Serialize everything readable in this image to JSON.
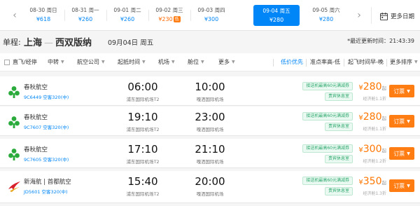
{
  "date_strip": {
    "prev_arrow": "‹",
    "next_arrow": "›",
    "dates": [
      {
        "label": "08-30 周日",
        "price": "¥618"
      },
      {
        "label": "08-31 周一",
        "price": "¥260"
      },
      {
        "label": "09-01 周二",
        "price": "¥260"
      },
      {
        "label": "09-02 周三",
        "price": "¥230",
        "tag": "低"
      },
      {
        "label": "09-03 周四",
        "price": "¥300"
      },
      {
        "label": "09-04 周五",
        "price": "¥280"
      },
      {
        "label": "09-05 周六",
        "price": "¥280"
      }
    ],
    "more_dates_label": "更多日期"
  },
  "route": {
    "trip_type": "单程:",
    "from": "上海",
    "dash": "—",
    "to": "西双版纳",
    "date": "09月04日 周五",
    "update_prefix": "*最近更新时间：",
    "update_time": "21:43:39"
  },
  "filters": {
    "direct_label": "直飞/经停",
    "items": [
      "中转",
      "航空公司",
      "起抵时间",
      "机场",
      "舱位",
      "更多"
    ],
    "sorts": [
      "低价优先",
      "准点率高-低",
      "起飞时间早-晚",
      "更多排序"
    ]
  },
  "flights": [
    {
      "airline": "春秋航空",
      "flight": "9C6449 空客320(中)",
      "dep_time": "06:00",
      "dep_airport": "浦东国际机场T2",
      "arr_time": "10:00",
      "arr_airport": "嘎洒国际机场",
      "promo1": "接送机最高60元满减券",
      "promo2": "贵宾休息室",
      "price": "280",
      "currency": "¥",
      "suffix": "起",
      "discount": "经济舱1.1折",
      "book": "订票"
    },
    {
      "airline": "春秋航空",
      "flight": "9C7607 空客320(中)",
      "dep_time": "19:10",
      "dep_airport": "浦东国际机场T2",
      "arr_time": "23:00",
      "arr_airport": "嘎洒国际机场",
      "promo1": "接送机最高60元满减券",
      "promo2": "贵宾休息室",
      "price": "280",
      "currency": "¥",
      "suffix": "起",
      "discount": "经济舱1.1折",
      "book": "订票"
    },
    {
      "airline": "春秋航空",
      "flight": "9C7605 空客320(中)",
      "dep_time": "17:10",
      "dep_airport": "浦东国际机场T2",
      "arr_time": "21:10",
      "arr_airport": "嘎洒国际机场",
      "promo1": "接送机最高60元满减券",
      "promo2": "贵宾休息室",
      "price": "300",
      "currency": "¥",
      "suffix": "起",
      "discount": "经济舱1.2折",
      "book": "订票"
    },
    {
      "airline": "新海航 | 首都航空",
      "flight": "JD5601 空客320(中)",
      "dep_time": "15:40",
      "dep_airport": "浦东国际机场T2",
      "arr_time": "20:00",
      "arr_airport": "嘎洒国际机场",
      "promo1": "接送机最高60元满减券",
      "promo2": "贵宾休息室",
      "price": "350",
      "currency": "¥",
      "suffix": "起",
      "discount": "经济舱1.3折",
      "book": "订票"
    }
  ],
  "colors": {
    "accent": "#0086f6",
    "price": "#ff7600",
    "book_button": "#ff7d13",
    "spring_green": "#2bab3c",
    "capital_red": "#d8202a"
  }
}
